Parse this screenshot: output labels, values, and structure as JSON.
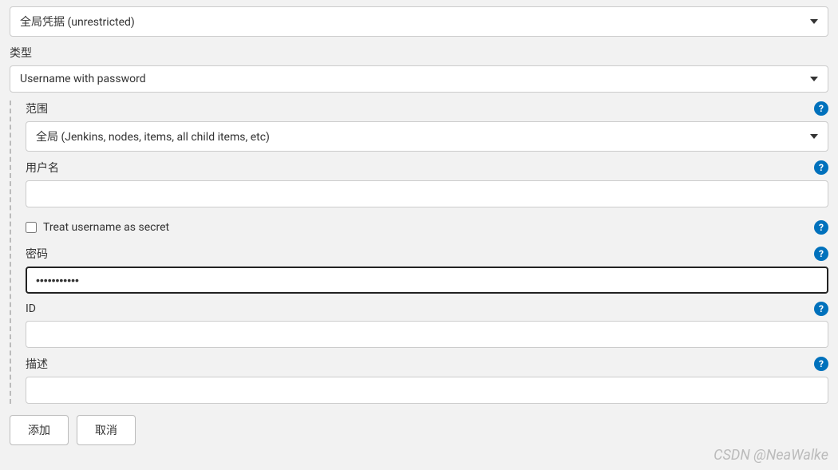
{
  "domain": {
    "value": "全局凭据 (unrestricted)"
  },
  "type": {
    "label": "类型",
    "value": "Username with password"
  },
  "scope": {
    "label": "范围",
    "value": "全局 (Jenkins, nodes, items, all child items, etc)"
  },
  "username": {
    "label": "用户名",
    "value": ""
  },
  "treat_secret": {
    "label": "Treat username as secret",
    "checked": false
  },
  "password": {
    "label": "密码",
    "value": "•••••••••••"
  },
  "id": {
    "label": "ID",
    "value": ""
  },
  "description": {
    "label": "描述",
    "value": ""
  },
  "buttons": {
    "add": "添加",
    "cancel": "取消"
  },
  "help_glyph": "?",
  "watermark": "CSDN @NeaWalke"
}
